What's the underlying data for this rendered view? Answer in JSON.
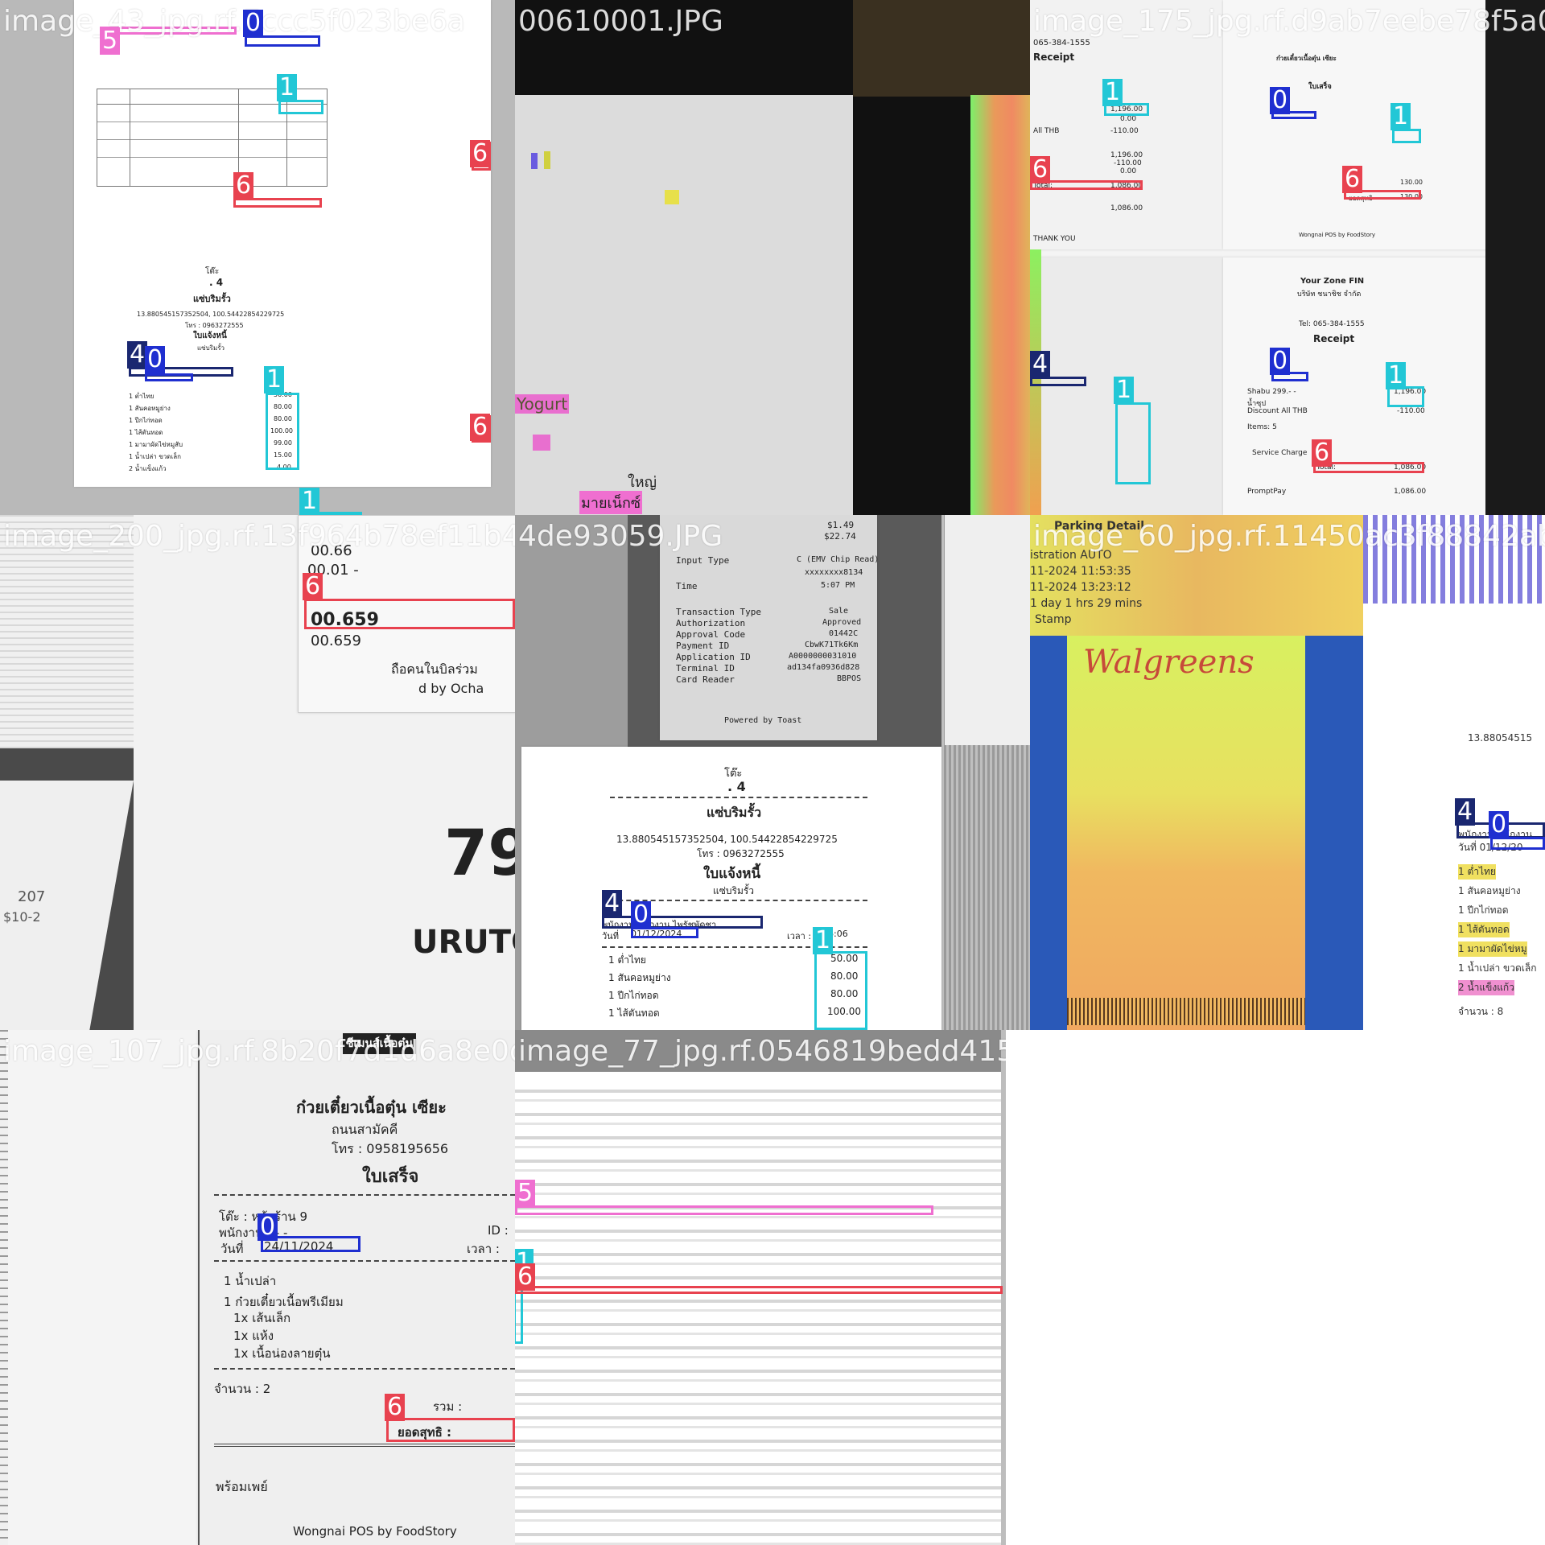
{
  "palette": {
    "class_0": "#1f2fd0",
    "class_1": "#22c7d6",
    "class_4": "#1a2770",
    "class_5": "#ef6fd0",
    "class_6": "#e8424f"
  },
  "tiles": [
    {
      "id": "t1",
      "filename": "image_43_jpg.rf.7ccc5f023be6a",
      "labels": [
        {
          "cls": "5",
          "text": "5"
        },
        {
          "cls": "0",
          "text": "0"
        },
        {
          "cls": "1",
          "text": "1"
        },
        {
          "cls": "6",
          "text": "6"
        },
        {
          "cls": "6",
          "text": "6"
        },
        {
          "cls": "4",
          "text": "4"
        },
        {
          "cls": "0",
          "text": "0"
        },
        {
          "cls": "1",
          "text": "1"
        },
        {
          "cls": "6",
          "text": "6"
        },
        {
          "cls": "1",
          "text": "1"
        }
      ],
      "receipt_text": [
        "โต๊ะ",
        ". 4",
        "แซ่บริมรั้ว",
        "13.880545157352504, 100.54422854229725",
        "โทร : 0963272555",
        "ใบแจ้งหนี้",
        "แซ่บริมรั้ว"
      ],
      "items": [
        "1 ต่ำไทย",
        "1 สันคอหมูย่าง",
        "1 ปีกไก่ทอด",
        "1 ไส้ตันทอด",
        "1 มามาผัดไข่หมูสับ",
        "1 น้ำเปล่า ขวดเล็ก",
        "2 น้ำแข็งแก้ว"
      ],
      "amounts": [
        "50.00",
        "80.00",
        "80.00",
        "100.00",
        "99.00",
        "15.00",
        "4.00"
      ]
    },
    {
      "id": "t2",
      "filename": "00610001.JPG",
      "labels": [],
      "fragments": [
        "Yogurt",
        "ใหญ่",
        "มายเน็กซ์"
      ]
    },
    {
      "id": "t3",
      "filename": "image_175_jpg.rf.d9ab7eebe78f5a0e",
      "labels": [
        {
          "cls": "1",
          "text": "1"
        },
        {
          "cls": "0",
          "text": "0"
        },
        {
          "cls": "1",
          "text": "1"
        },
        {
          "cls": "6",
          "text": "6"
        },
        {
          "cls": "6",
          "text": "6"
        },
        {
          "cls": "4",
          "text": "4"
        },
        {
          "cls": "1",
          "text": "1"
        },
        {
          "cls": "0",
          "text": "0"
        },
        {
          "cls": "1",
          "text": "1"
        },
        {
          "cls": "6",
          "text": "6"
        }
      ],
      "lines": [
        "065-384-1555",
        "Receipt",
        "1,196.00",
        "0.00",
        "All THB",
        "-110.00",
        "1,196.00",
        "-110.00",
        "0.00",
        "Total:",
        "1,086.00",
        "1,086.00",
        "THANK YOU",
        "ก๋วยเตี๋ยวเนื้อตุ๋น เซียะ",
        "ใบเสร็จ",
        "Wongnai POS by FoodStory",
        "Your Zone FIN",
        "บริษัท ชนาชิช จำกัด",
        "Tel: 065-384-1555",
        "Receipt",
        "Shabu 299.- -",
        "1,196.00",
        "น้ำซุป",
        "Discount All THB",
        "-110.00",
        "Items: 5",
        "Service Charge",
        "Total:",
        "1,086.00",
        "PromptPay",
        "1,086.00",
        "130.00",
        "130.00",
        "ยอดสุทธิ"
      ]
    },
    {
      "id": "t4",
      "filename": "image_200_jpg.rf.13f964b78ef11b405",
      "labels": [
        {
          "cls": "6",
          "text": "6"
        }
      ],
      "fragments": [
        "00.66",
        "00.01 -",
        "00.659",
        "00.659",
        "d by Ocha",
        "ถือคนในบิลร่วม",
        "79",
        "URUTO",
        "207",
        "$10-2"
      ]
    },
    {
      "id": "t5",
      "filename": "4de93059.JPG",
      "labels": [
        {
          "cls": "4",
          "text": "4"
        },
        {
          "cls": "0",
          "text": "0"
        },
        {
          "cls": "1",
          "text": "1"
        }
      ],
      "toast_rows": [
        {
          "k": "Input Type",
          "v": "C (EMV Chip Read)"
        },
        {
          "k": "Time",
          "v": "5:07 PM"
        },
        {
          "k": "Transaction Type",
          "v": "Sale"
        },
        {
          "k": "Authorization",
          "v": "Approved"
        },
        {
          "k": "Approval Code",
          "v": "01442C"
        },
        {
          "k": "Payment ID",
          "v": "CbwK71Tk6Km"
        },
        {
          "k": "Application ID",
          "v": "A0000000031010"
        },
        {
          "k": "Terminal ID",
          "v": "ad134fa0936d828"
        },
        {
          "k": "Card Reader",
          "v": "BBPOS"
        }
      ],
      "toast_footer": "Powered by Toast",
      "toast_top": [
        "$1.49",
        "$22.74",
        "xxxxxxxx8134"
      ],
      "receipt_text": [
        "โต๊ะ",
        ". 4",
        "แซ่บริมรั้ว",
        "13.880545157352504, 100.54422854229725",
        "โทร : 0963272555",
        "ใบแจ้งหนี้",
        "แซ่บริมรั้ว"
      ],
      "staff_line": "พนักงาน พนักงาน ไพรัชพัดชา",
      "date_label": "วันที่",
      "date_value": "01/12/2024",
      "time_label": "เวลา :",
      "time_value": "16:06",
      "items": [
        "1 ต่ำไทย",
        "1 สันคอหมูย่าง",
        "1 ปีกไก่ทอด",
        "1 ไส้ตันทอด"
      ],
      "amounts": [
        "50.00",
        "80.00",
        "80.00",
        "100.00"
      ]
    },
    {
      "id": "t6",
      "filename": "image_60_jpg.rf.11450ac3f88842abcd",
      "labels": [
        {
          "cls": "4",
          "text": "4"
        },
        {
          "cls": "0",
          "text": "0"
        }
      ],
      "parking": [
        "Parking Detail",
        "istration AUTO",
        "11-2024 11:53:35",
        "11-2024 13:23:12",
        "1 day 1 hrs 29 mins",
        "Stamp"
      ],
      "brand": "Walgreens",
      "right_frag": [
        "13.88054515",
        "พนักงาน พนักงาน",
        "วันที่ 01/12/20",
        "1 ต่ำไทย",
        "1 สันคอหมูย่าง",
        "1 ปีกไก่ทอด",
        "1 ไส้ตันทอด",
        "1 มามาผัดไข่หมู",
        "1 น้ำเปล่า ขวดเล็ก",
        "2 น้ำแข็งแก้ว",
        "จำนวน : 8"
      ]
    },
    {
      "id": "t7",
      "filename": "image_107_jpg.rf.8b20f7d1d6a8e0dc7c842c",
      "labels": [
        {
          "cls": "0",
          "text": "0"
        },
        {
          "cls": "6",
          "text": "6"
        }
      ],
      "shop": "ก๋วยเตี๋ยวเนื้อตุ๋น เซียะ",
      "street": "ถนนสามัคคี",
      "phone": "โทร : 0958195656",
      "doc": "ใบเสร็จ",
      "table": "โต๊ะ : หน้าร้าน 9",
      "staff": "พนักงาน : - -",
      "id_label": "ID :",
      "date_label": "วันที่",
      "date_value": "24/11/2024",
      "time_label": "เวลา :",
      "items": [
        "1 น้ำเปล่า",
        "1 ก๋วยเตี๋ยวเนื้อพรีเมียม",
        "1x เส้นเล็ก",
        "1x แห้ง",
        "1x เนื้อน่องลายตุ๋น"
      ],
      "qty": "จำนวน : 2",
      "total_label": "รวม :",
      "net_label": "ยอดสุทธิ :",
      "pay": "พร้อมเพย์",
      "footer": "Wongnai POS by FoodStory",
      "top_logo": "ซีเมนส์เนื้อตุ๋น"
    },
    {
      "id": "t8",
      "filename": "image_77_jpg.rf.0546819bedd4158e14c3429c",
      "labels": [
        {
          "cls": "5",
          "text": "5"
        },
        {
          "cls": "1",
          "text": "1"
        },
        {
          "cls": "6",
          "text": "6"
        }
      ]
    }
  ]
}
